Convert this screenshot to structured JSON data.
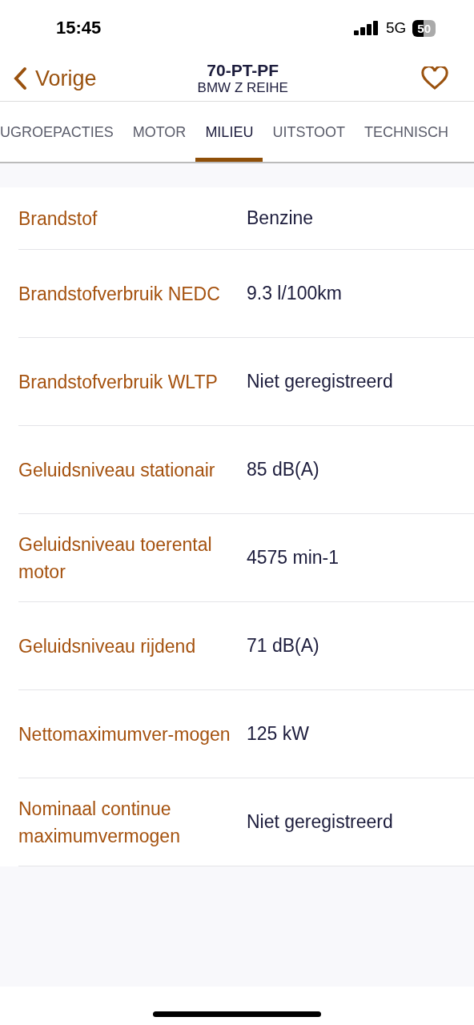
{
  "status_bar": {
    "time": "15:45",
    "network": "5G",
    "battery": "50"
  },
  "nav": {
    "back": "Vorige",
    "title": "70-PT-PF",
    "subtitle": "BMW Z REIHE",
    "favorite": false
  },
  "tabs": [
    {
      "label": "UGROEPACTIES",
      "selected": false
    },
    {
      "label": "MOTOR",
      "selected": false
    },
    {
      "label": "MILIEU",
      "selected": true
    },
    {
      "label": "UITSTOOT",
      "selected": false
    },
    {
      "label": "TECHNISCH",
      "selected": false
    }
  ],
  "rows": [
    {
      "label": "Brandstof",
      "value": "Benzine"
    },
    {
      "label": "Brandstofverbruik NEDC",
      "value": "9.3 l/100km"
    },
    {
      "label": "Brandstofverbruik WLTP",
      "value": "Niet geregistreerd"
    },
    {
      "label": "Geluidsniveau stationair",
      "value": "85 dB(A)"
    },
    {
      "label": "Geluidsniveau toerental motor",
      "value": "4575 min-1"
    },
    {
      "label": "Geluidsniveau rijdend",
      "value": "71 dB(A)"
    },
    {
      "label": "Nettomaximumver-mogen",
      "value": "125 kW"
    },
    {
      "label": "Nominaal continue maximumvermogen",
      "value": "Niet geregistreerd"
    }
  ]
}
